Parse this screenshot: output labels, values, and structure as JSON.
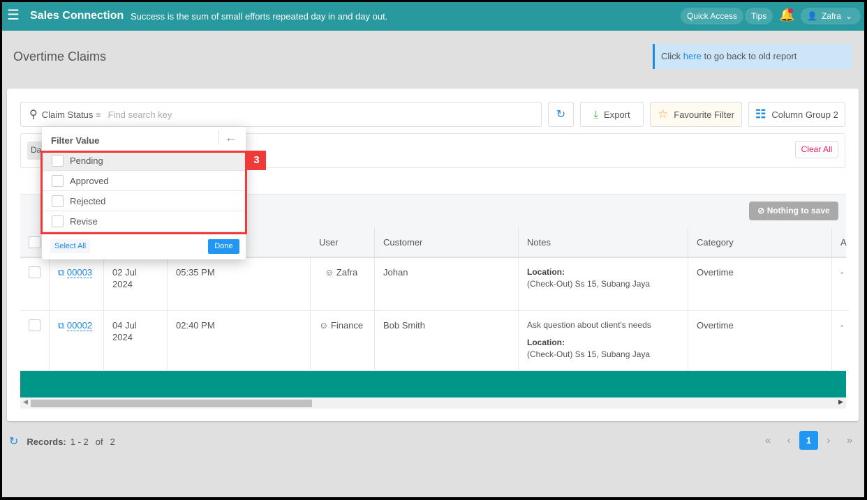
{
  "header": {
    "app_name": "Sales Connection",
    "tagline": "Success is the sum of small efforts repeated day in and day out.",
    "quick_access": "Quick Access",
    "tips": "Tips",
    "user": "Zafra"
  },
  "page": {
    "title": "Overtime Claims",
    "info_prefix": "Click",
    "info_link": "here",
    "info_suffix": "to go back to old report"
  },
  "toolbar": {
    "search_field": "Claim Status =",
    "search_placeholder": "Find search key",
    "export": "Export",
    "favourite": "Favourite Filter",
    "column_group": "Column Group 2",
    "chip": "Da",
    "clear_all": "Clear All",
    "nothing_to_save": "Nothing to save"
  },
  "filter_popup": {
    "title": "Filter Value",
    "options": [
      "Pending",
      "Approved",
      "Rejected",
      "Revise"
    ],
    "select_all": "Select All",
    "done": "Done",
    "step_badge": "3"
  },
  "table": {
    "columns": [
      "User",
      "Customer",
      "Notes",
      "Category",
      "A"
    ],
    "rows": [
      {
        "claim_no": "00003",
        "date": "02 Jul 2024",
        "time": "05:35 PM",
        "user": "Zafra",
        "customer": "Johan",
        "note": "",
        "location_label": "Location:",
        "location": "(Check-Out) Ss 15, Subang Jaya",
        "category": "Overtime",
        "extra": "-"
      },
      {
        "claim_no": "00002",
        "date": "04 Jul 2024",
        "time": "02:40 PM",
        "user": "Finance",
        "customer": "Bob Smith",
        "note": "Ask question about client's needs",
        "location_label": "Location:",
        "location": "(Check-Out) Ss 15, Subang Jaya",
        "category": "Overtime",
        "extra": "-"
      }
    ]
  },
  "footer": {
    "records_label": "Records:",
    "records_range": "1 - 2",
    "of": "of",
    "total": "2",
    "current_page": "1"
  },
  "colors": {
    "topbar": "#27999f",
    "accent": "#1e88e5",
    "table_footer": "#009688",
    "highlight": "#f03a3a"
  }
}
